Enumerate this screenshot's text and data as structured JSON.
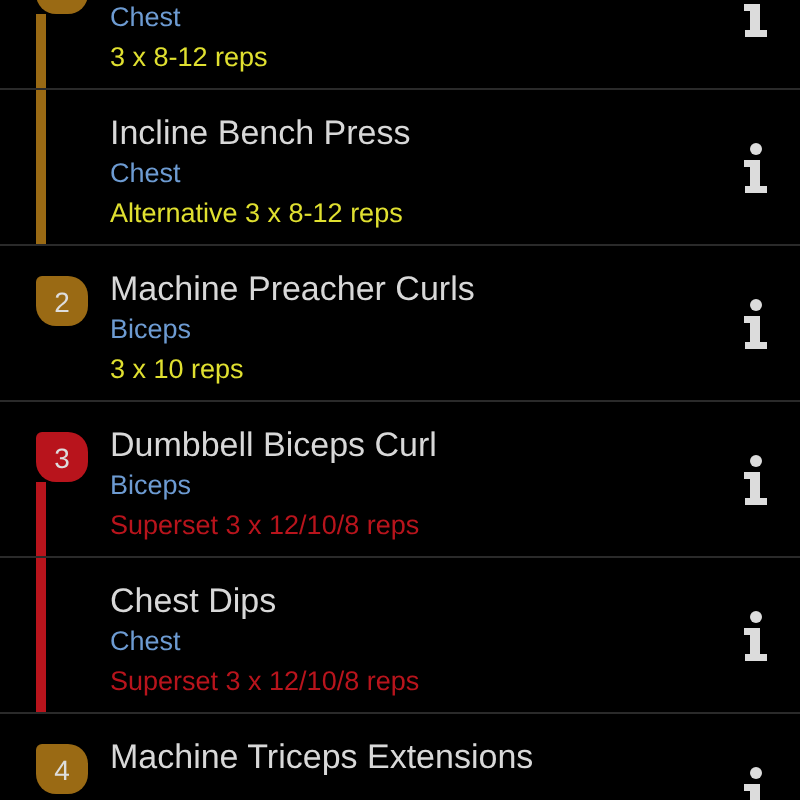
{
  "groups": [
    {
      "color": "#9a6a14",
      "kind": "group",
      "exercises": [
        {
          "muscle": "Chest",
          "sets": "3 x 8-12 reps"
        },
        {
          "name": "Incline Bench Press",
          "muscle": "Chest",
          "sets": "Alternative 3 x 8-12 reps"
        }
      ]
    },
    {
      "number": "2",
      "color": "#9a6a14",
      "kind": "single",
      "exercises": [
        {
          "name": "Machine Preacher Curls",
          "muscle": "Biceps",
          "sets": "3 x 10 reps"
        }
      ]
    },
    {
      "number": "3",
      "color": "#b8141c",
      "kind": "superset",
      "exercises": [
        {
          "name": "Dumbbell Biceps Curl",
          "muscle": "Biceps",
          "sets": "Superset 3 x 12/10/8 reps"
        },
        {
          "name": "Chest Dips",
          "muscle": "Chest",
          "sets": "Superset 3 x 12/10/8 reps"
        }
      ]
    },
    {
      "number": "4",
      "color": "#9a6a14",
      "kind": "single",
      "exercises": [
        {
          "name": "Machine Triceps Extensions"
        }
      ]
    }
  ]
}
